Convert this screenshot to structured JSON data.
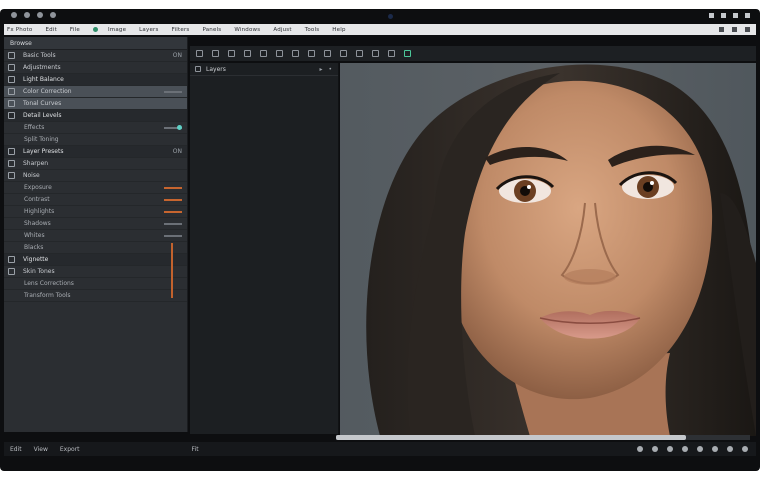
{
  "app": {
    "menu": [
      "Fx Photo",
      "Edit",
      "File",
      "Image",
      "Layers",
      "Filters",
      "Panels",
      "Windows",
      "Adjust",
      "Tools",
      "Help"
    ]
  },
  "left_panel": {
    "title": "Browse",
    "rows": [
      {
        "label": "Basic Tools",
        "value": "ON"
      },
      {
        "label": "Adjustments"
      },
      {
        "label": "Light Balance"
      },
      {
        "label": "Color Correction",
        "highlight": true
      },
      {
        "label": "Tonal Curves"
      },
      {
        "label": "Detail Levels"
      },
      {
        "label": "Effects"
      },
      {
        "label": "Split Toning"
      },
      {
        "label": "Layer Presets",
        "value": "ON"
      },
      {
        "label": "Sharpen"
      },
      {
        "label": "Noise"
      },
      {
        "label": "Exposure"
      },
      {
        "label": "Contrast"
      },
      {
        "label": "Highlights"
      },
      {
        "label": "Shadows"
      },
      {
        "label": "Whites"
      },
      {
        "label": "Blacks"
      },
      {
        "label": "Vignette"
      },
      {
        "label": "Skin Tones"
      },
      {
        "label": "Lens Corrections"
      },
      {
        "label": "Transform Tools"
      }
    ]
  },
  "mid_panel": {
    "title": "Layers"
  },
  "bottom": {
    "labels": [
      "Edit",
      "View",
      "Export",
      "Fit"
    ]
  },
  "colors": {
    "accent_teal": "#5fd1c6",
    "accent_orange": "#c2622d",
    "accent_green": "#4cc79a"
  }
}
